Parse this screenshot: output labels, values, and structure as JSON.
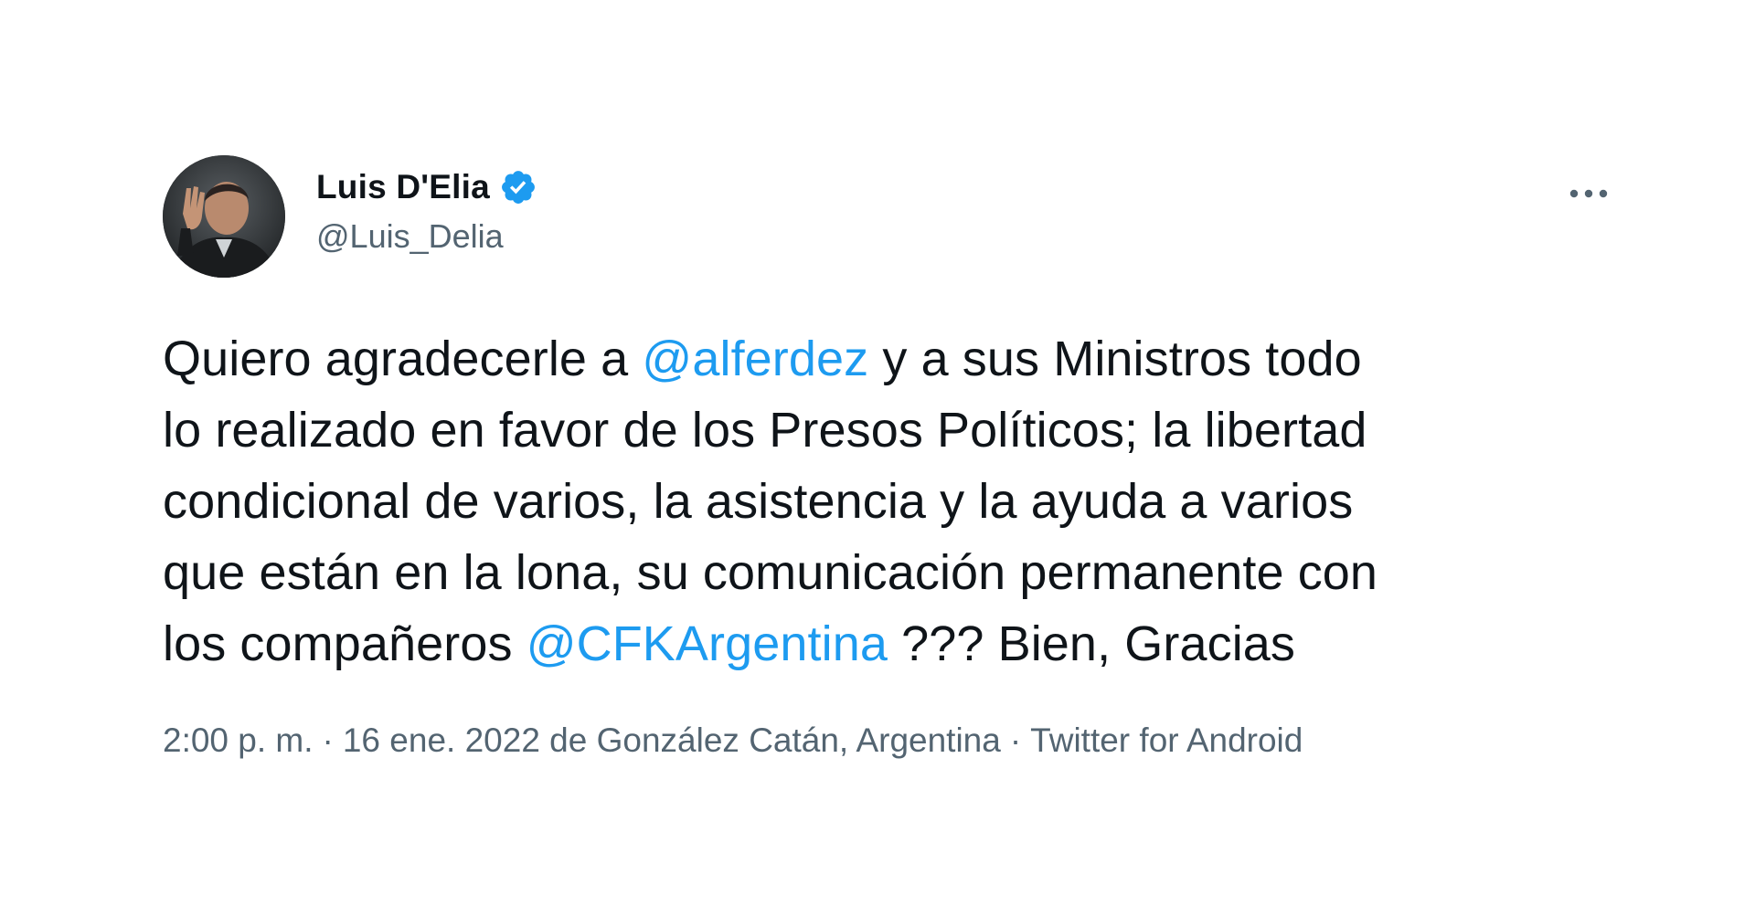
{
  "author": {
    "display_name": "Luis D'Elia",
    "handle": "@Luis_Delia",
    "verified_icon": "verified-badge-icon",
    "avatar": "profile-photo"
  },
  "more_icon": "more-options-icon",
  "tweet": {
    "lines": [
      [
        {
          "text": "Quiero agradecerle a ",
          "type": "text"
        },
        {
          "text": "@alferdez",
          "type": "mention"
        },
        {
          "text": " y a sus Ministros todo",
          "type": "text"
        }
      ],
      [
        {
          "text": "lo realizado en favor de los Presos Políticos; la libertad",
          "type": "text"
        }
      ],
      [
        {
          "text": "condicional de varios, la asistencia y la ayuda a varios",
          "type": "text"
        }
      ],
      [
        {
          "text": "que están en la lona, su comunicación permanente con",
          "type": "text"
        }
      ],
      [
        {
          "text": "los compañeros ",
          "type": "text"
        },
        {
          "text": "@CFKArgentina",
          "type": "mention"
        },
        {
          "text": " ??? Bien, Gracias",
          "type": "text"
        }
      ]
    ]
  },
  "meta": {
    "time": "2:00 p. m.",
    "separator": "·",
    "date_location": "16 ene. 2022 de González Catán, Argentina",
    "source": "Twitter for Android"
  },
  "colors": {
    "accent": "#1d9bf0",
    "text": "#0f1419",
    "secondary": "#536471"
  }
}
